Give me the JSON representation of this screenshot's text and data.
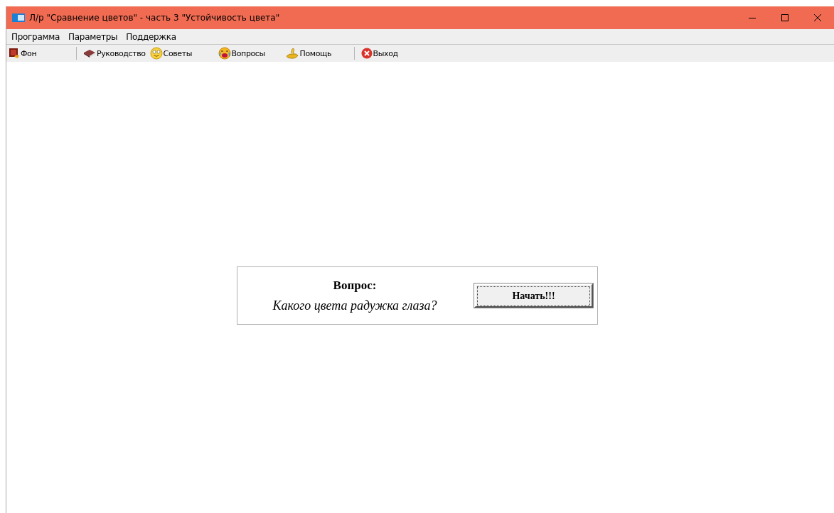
{
  "window": {
    "title": "Л/р \"Сравнение цветов\" - часть 3 \"Устойчивость цвета\""
  },
  "menu": [
    "Программа",
    "Параметры",
    "Поддержка"
  ],
  "toolbar_groups": [
    [
      {
        "label": "Фон",
        "kind": "picture"
      }
    ],
    [
      {
        "label": "Руководство",
        "kind": "book"
      },
      {
        "label": "Советы",
        "kind": "smile"
      },
      {
        "label": "Вопросы",
        "kind": "cry"
      },
      {
        "label": "Помощь",
        "kind": "hand"
      }
    ],
    [
      {
        "label": "Выход",
        "kind": "exit"
      }
    ]
  ],
  "question": {
    "heading": "Вопрос:",
    "text": "Какого цвета радужка глаза?",
    "button": "Начать!!!"
  }
}
